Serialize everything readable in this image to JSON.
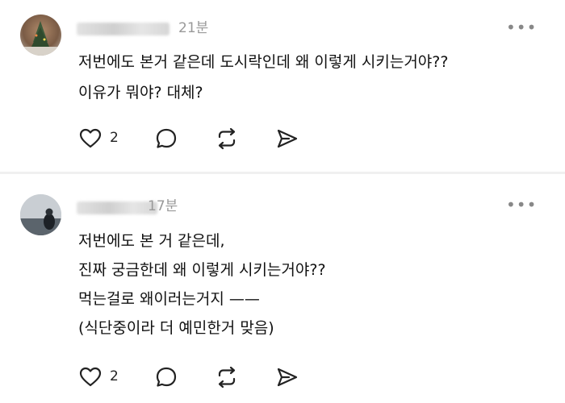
{
  "posts": [
    {
      "time": "21분",
      "lines": [
        "저번에도 본거 같은데 도시락인데 왜 이렇게 시키는거야??",
        "이유가 뭐야? 대체?"
      ],
      "likes": "2"
    },
    {
      "time": "17분",
      "lines": [
        "저번에도 본 거 같은데,",
        "진짜 궁금한데 왜 이렇게 시키는거야??",
        "먹는걸로 왜이러는거지 ——",
        "(식단중이라 더 예민한거 맞음)"
      ],
      "likes": "2"
    }
  ],
  "icons": {
    "more": "more-horizontal-icon",
    "like": "heart-icon",
    "reply": "comment-bubble-icon",
    "repost": "repost-icon",
    "share": "send-icon"
  }
}
